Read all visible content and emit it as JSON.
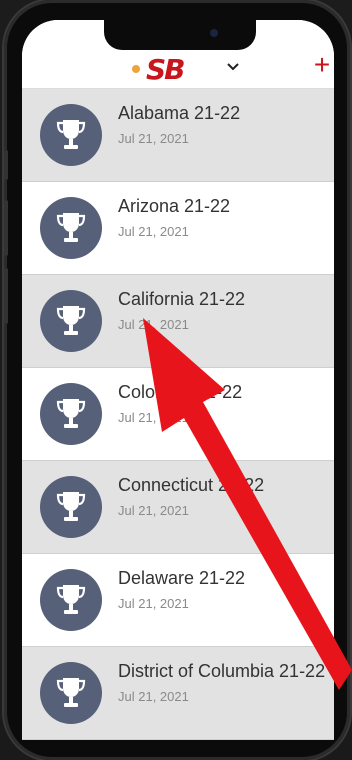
{
  "app": {
    "logo_text": "SB",
    "add_label": "+"
  },
  "list": {
    "items": [
      {
        "title": "Alabama 21-22",
        "date": "Jul 21, 2021",
        "icon": "trophy-icon"
      },
      {
        "title": "Arizona 21-22",
        "date": "Jul 21, 2021",
        "icon": "trophy-icon"
      },
      {
        "title": "California 21-22",
        "date": "Jul 21, 2021",
        "icon": "trophy-icon"
      },
      {
        "title": "Colorado 21-22",
        "date": "Jul 21, 2021",
        "icon": "trophy-icon"
      },
      {
        "title": "Connecticut 21-22",
        "date": "Jul 21, 2021",
        "icon": "trophy-icon"
      },
      {
        "title": "Delaware 21-22",
        "date": "Jul 21, 2021",
        "icon": "trophy-icon"
      },
      {
        "title": "District of Columbia 21-22",
        "date": "Jul 21, 2021",
        "icon": "trophy-icon"
      }
    ]
  },
  "colors": {
    "brand_red": "#c8161d",
    "avatar_bg": "#566079",
    "highlight_row": "#e2e2e2",
    "annotation_arrow": "#e8141b"
  }
}
